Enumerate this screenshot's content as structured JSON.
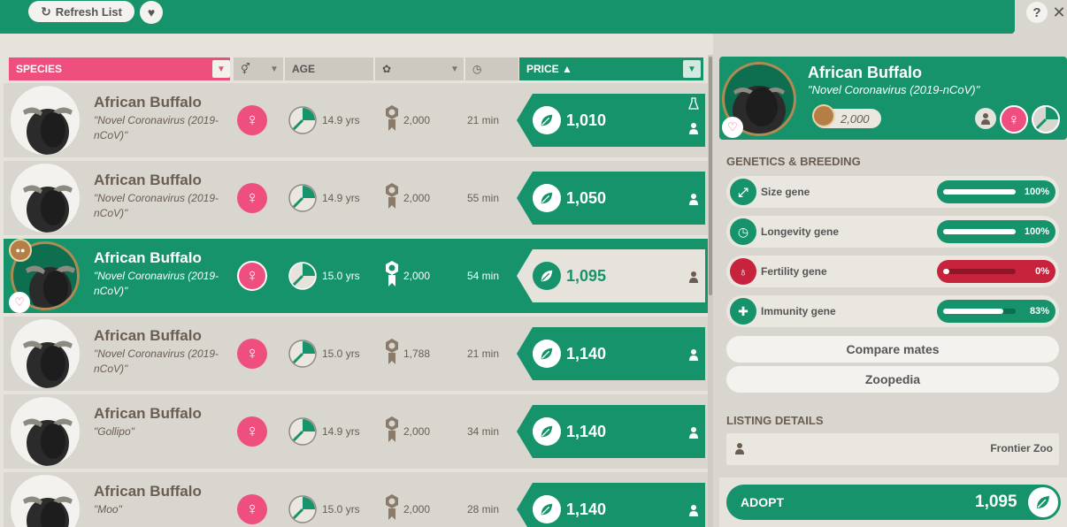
{
  "toolbar": {
    "refresh_label": "Refresh List",
    "help_label": "?",
    "close_label": "✕"
  },
  "list_header": {
    "species": "SPECIES",
    "age": "AGE",
    "price": "PRICE ▲"
  },
  "rows": [
    {
      "name": "African Buffalo",
      "sub": "\"Novel Coronavirus (2019-nCoV)\"",
      "age": "14.9 yrs",
      "fertility": "2,000",
      "time": "21 min",
      "price": "1,010",
      "selected": false
    },
    {
      "name": "African Buffalo",
      "sub": "\"Novel Coronavirus (2019-nCoV)\"",
      "age": "14.9 yrs",
      "fertility": "2,000",
      "time": "55 min",
      "price": "1,050",
      "selected": false
    },
    {
      "name": "African Buffalo",
      "sub": "\"Novel Coronavirus (2019-nCoV)\"",
      "age": "15.0 yrs",
      "fertility": "2,000",
      "time": "54 min",
      "price": "1,095",
      "selected": true
    },
    {
      "name": "African Buffalo",
      "sub": "\"Novel Coronavirus (2019-nCoV)\"",
      "age": "15.0 yrs",
      "fertility": "1,788",
      "time": "21 min",
      "price": "1,140",
      "selected": false
    },
    {
      "name": "African Buffalo",
      "sub": "\"Gollipo\"",
      "age": "14.9 yrs",
      "fertility": "2,000",
      "time": "34 min",
      "price": "1,140",
      "selected": false
    },
    {
      "name": "African Buffalo",
      "sub": "\"Moo\"",
      "age": "15.0 yrs",
      "fertility": "2,000",
      "time": "28 min",
      "price": "1,140",
      "selected": false
    }
  ],
  "detail": {
    "name": "African Buffalo",
    "sub": "\"Novel Coronavirus (2019-nCoV)\"",
    "fertility": "2,000",
    "genetics_title": "GENETICS & BREEDING",
    "genes": [
      {
        "label": "Size gene",
        "value": "100%",
        "fraction": 1.0,
        "color": "#16936a"
      },
      {
        "label": "Longevity gene",
        "value": "100%",
        "fraction": 1.0,
        "color": "#16936a"
      },
      {
        "label": "Fertility gene",
        "value": "0%",
        "fraction": 0.0,
        "color": "#c8233d"
      },
      {
        "label": "Immunity gene",
        "value": "83%",
        "fraction": 0.83,
        "color": "#16936a"
      }
    ],
    "compare_label": "Compare mates",
    "zoopedia_label": "Zoopedia",
    "listing_title": "LISTING DETAILS",
    "listing_owner": "Frontier Zoo",
    "adopt_label": "ADOPT",
    "adopt_price": "1,095"
  },
  "colors": {
    "accent": "#16936a",
    "pink": "#ef4f7e",
    "red": "#c8233d"
  }
}
